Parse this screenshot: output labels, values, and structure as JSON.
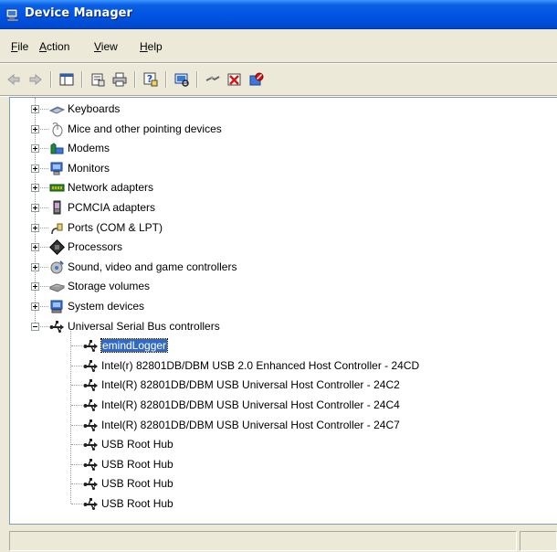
{
  "window": {
    "title": "Device Manager"
  },
  "menu": [
    {
      "pre": "",
      "u": "F",
      "post": "ile"
    },
    {
      "pre": "",
      "u": "A",
      "post": "ction"
    },
    {
      "pre": "",
      "u": "V",
      "post": "iew"
    },
    {
      "pre": "",
      "u": "H",
      "post": "elp"
    }
  ],
  "toolbar": {
    "buttons": [
      "back-icon",
      "forward-icon",
      "show-hide-console-tree-icon",
      "properties-icon",
      "print-icon",
      "help-icon",
      "scan-hardware-icon",
      "update-driver-icon",
      "uninstall-icon",
      "disable-icon"
    ]
  },
  "tree": {
    "categories": [
      {
        "label": "Keyboards",
        "icon": "keyboard-icon"
      },
      {
        "label": "Mice and other pointing devices",
        "icon": "mouse-icon"
      },
      {
        "label": "Modems",
        "icon": "modem-icon"
      },
      {
        "label": "Monitors",
        "icon": "monitor-icon"
      },
      {
        "label": "Network adapters",
        "icon": "network-adapter-icon"
      },
      {
        "label": "PCMCIA adapters",
        "icon": "pcmcia-icon"
      },
      {
        "label": "Ports (COM & LPT)",
        "icon": "port-icon"
      },
      {
        "label": "Processors",
        "icon": "processor-icon"
      },
      {
        "label": "Sound, video and game controllers",
        "icon": "sound-icon"
      },
      {
        "label": "Storage volumes",
        "icon": "storage-icon"
      },
      {
        "label": "System devices",
        "icon": "system-devices-icon"
      },
      {
        "label": "Universal Serial Bus controllers",
        "icon": "usb-icon"
      }
    ],
    "usb_children": [
      {
        "label": "emindLogger",
        "selected": true
      },
      {
        "label": "Intel(r) 82801DB/DBM USB 2.0 Enhanced Host Controller - 24CD"
      },
      {
        "label": "Intel(R) 82801DB/DBM USB Universal Host Controller - 24C2"
      },
      {
        "label": "Intel(R) 82801DB/DBM USB Universal Host Controller - 24C4"
      },
      {
        "label": "Intel(R) 82801DB/DBM USB Universal Host Controller - 24C7"
      },
      {
        "label": "USB Root Hub"
      },
      {
        "label": "USB Root Hub"
      },
      {
        "label": "USB Root Hub"
      },
      {
        "label": "USB Root Hub"
      }
    ]
  },
  "colors": {
    "titlebar": "#0054e3",
    "selection": "#316ac5",
    "chrome": "#ece9d8"
  }
}
